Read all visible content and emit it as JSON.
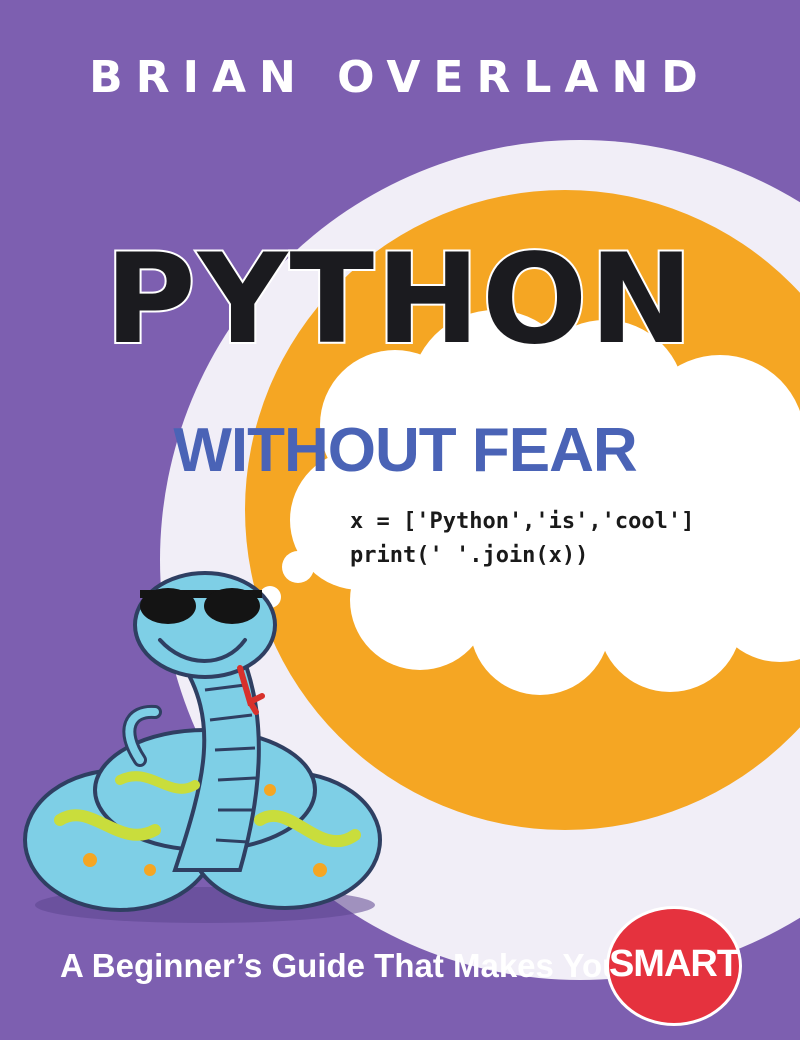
{
  "cover": {
    "author": "BRIAN OVERLAND",
    "title": "PYTHON",
    "subtitle": "WITHOUT FEAR",
    "code_lines": [
      "x = ['Python','is','cool']",
      "print(' '.join(x))"
    ],
    "tagline": "A Beginner’s Guide That Makes You Feel",
    "badge_text": "SMART"
  },
  "colors": {
    "background": "#7d5fb0",
    "ring_outer": "#f1eef7",
    "ring_orange": "#f5a623",
    "title": "#1b1b1f",
    "subtitle": "#4a63b6",
    "badge": "#e5323e",
    "snake": "#7ecfe6",
    "snake_spots": "#c9dd3c"
  },
  "icons": [
    "snake-mascot",
    "sunglasses",
    "thought-cloud"
  ]
}
